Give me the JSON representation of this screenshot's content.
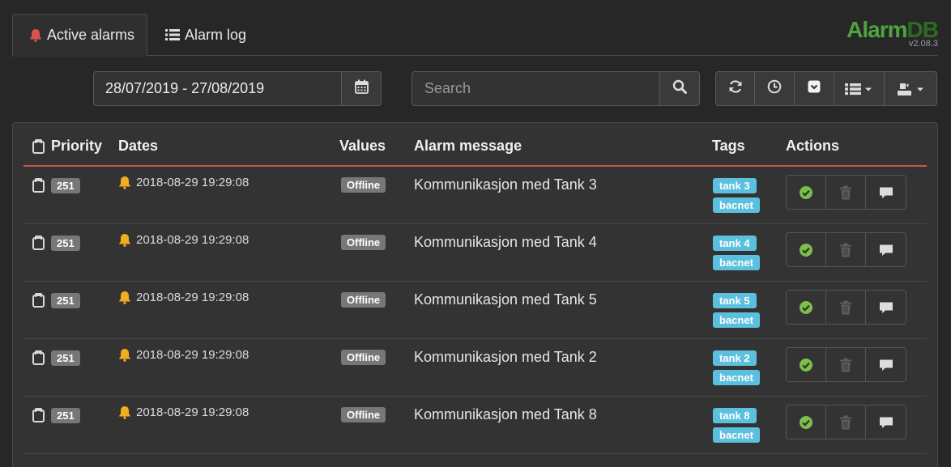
{
  "tabs": {
    "active_label": "Active alarms",
    "log_label": "Alarm log"
  },
  "brand": {
    "name_a": "Alarm",
    "name_b": "DB",
    "version": "v2.08.3"
  },
  "toolbar": {
    "date_range": "28/07/2019 - 27/08/2019",
    "search_placeholder": "Search"
  },
  "table": {
    "headers": {
      "priority": "Priority",
      "dates": "Dates",
      "values": "Values",
      "message": "Alarm message",
      "tags": "Tags",
      "actions": "Actions"
    },
    "rows": [
      {
        "priority": "251",
        "date": "2018-08-29 19:29:08",
        "value": "Offline",
        "message": "Kommunikasjon med Tank 3",
        "tags": [
          "tank 3",
          "bacnet"
        ]
      },
      {
        "priority": "251",
        "date": "2018-08-29 19:29:08",
        "value": "Offline",
        "message": "Kommunikasjon med Tank 4",
        "tags": [
          "tank 4",
          "bacnet"
        ]
      },
      {
        "priority": "251",
        "date": "2018-08-29 19:29:08",
        "value": "Offline",
        "message": "Kommunikasjon med Tank 5",
        "tags": [
          "tank 5",
          "bacnet"
        ]
      },
      {
        "priority": "251",
        "date": "2018-08-29 19:29:08",
        "value": "Offline",
        "message": "Kommunikasjon med Tank 2",
        "tags": [
          "tank 2",
          "bacnet"
        ]
      },
      {
        "priority": "251",
        "date": "2018-08-29 19:29:08",
        "value": "Offline",
        "message": "Kommunikasjon med Tank 8",
        "tags": [
          "tank 8",
          "bacnet"
        ]
      }
    ]
  },
  "colors": {
    "background": "#272727",
    "panel": "#333333",
    "accent_green": "#4ea43d",
    "alarm_red": "#d9534f",
    "tag_blue": "#5bc0de",
    "bell_yellow": "#f0ad1e",
    "header_rule": "#c9574a"
  }
}
